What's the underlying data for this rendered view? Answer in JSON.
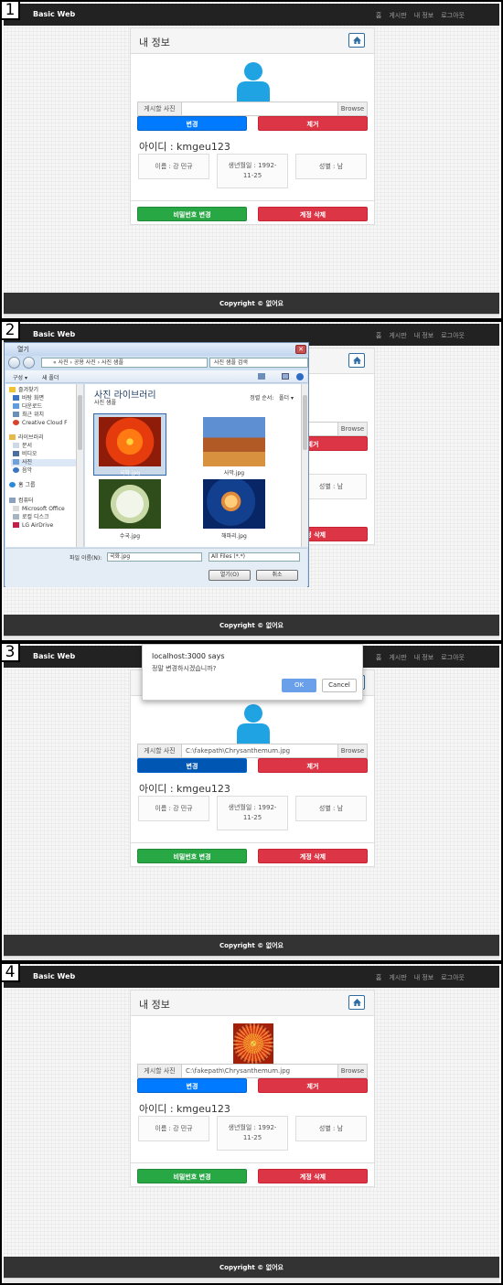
{
  "steps": [
    "1",
    "2",
    "3",
    "4"
  ],
  "navbar": {
    "brand": "Basic Web",
    "links": [
      "홈",
      "게시판",
      "내 정보",
      "로그아웃"
    ]
  },
  "card": {
    "title": "내 정보",
    "file_label": "게시할 사진",
    "file_browse": "Browse",
    "file_path_selected": "C:\\fakepath\\Chrysanthemum.jpg",
    "change_button": "변경",
    "remove_button": "제거",
    "user_id": "아이디 : kmgeu123",
    "name": "이름 : 강 민규",
    "birth": "생년월일 : 1992-11-25",
    "birth_line1": "생년월일 : 1992-",
    "birth_line2": "11-25",
    "gender": "성별 : 남",
    "password_button": "비밀번호 변경",
    "delete_button": "계정 삭제"
  },
  "footer": {
    "copyright": "Copyright © 없어요"
  },
  "file_dialog": {
    "title": "열기",
    "address": "« 사진 › 공용 사진 › 사진 샘플",
    "search_placeholder": "사진 샘플 검색",
    "organize": "구성 ▾",
    "new_folder": "새 폴더",
    "tree": [
      "즐겨찾기",
      "바탕 화면",
      "다운로드",
      "최근 위치",
      "Creative Cloud F",
      "라이브러리",
      "문서",
      "비디오",
      "사진",
      "음악",
      "홈 그룹",
      "컴퓨터",
      "Microsoft Office",
      "로컬 디스크",
      "LG AirDrive"
    ],
    "library_title": "사진 라이브러리",
    "library_sub": "사진 샘플",
    "sort_label": "정렬 순서:",
    "sort_value": "폴더 ▾",
    "files": [
      "국화.jpg",
      "사막.jpg",
      "수국.jpg",
      "해파리.jpg"
    ],
    "filename_label": "파일 이름(N):",
    "filename_value": "국화.jpg",
    "filter_value": "All Files (*.*)",
    "open_button": "열기(O)",
    "cancel_button": "취소"
  },
  "alert_dialog": {
    "host": "localhost:3000 says",
    "message": "정말 변경하시겠습니까?",
    "ok": "OK",
    "cancel": "Cancel"
  },
  "colors": {
    "primary": "#007bff",
    "danger": "#dc3545",
    "success": "#28a745",
    "navbar": "#222222",
    "footer": "#333333"
  }
}
